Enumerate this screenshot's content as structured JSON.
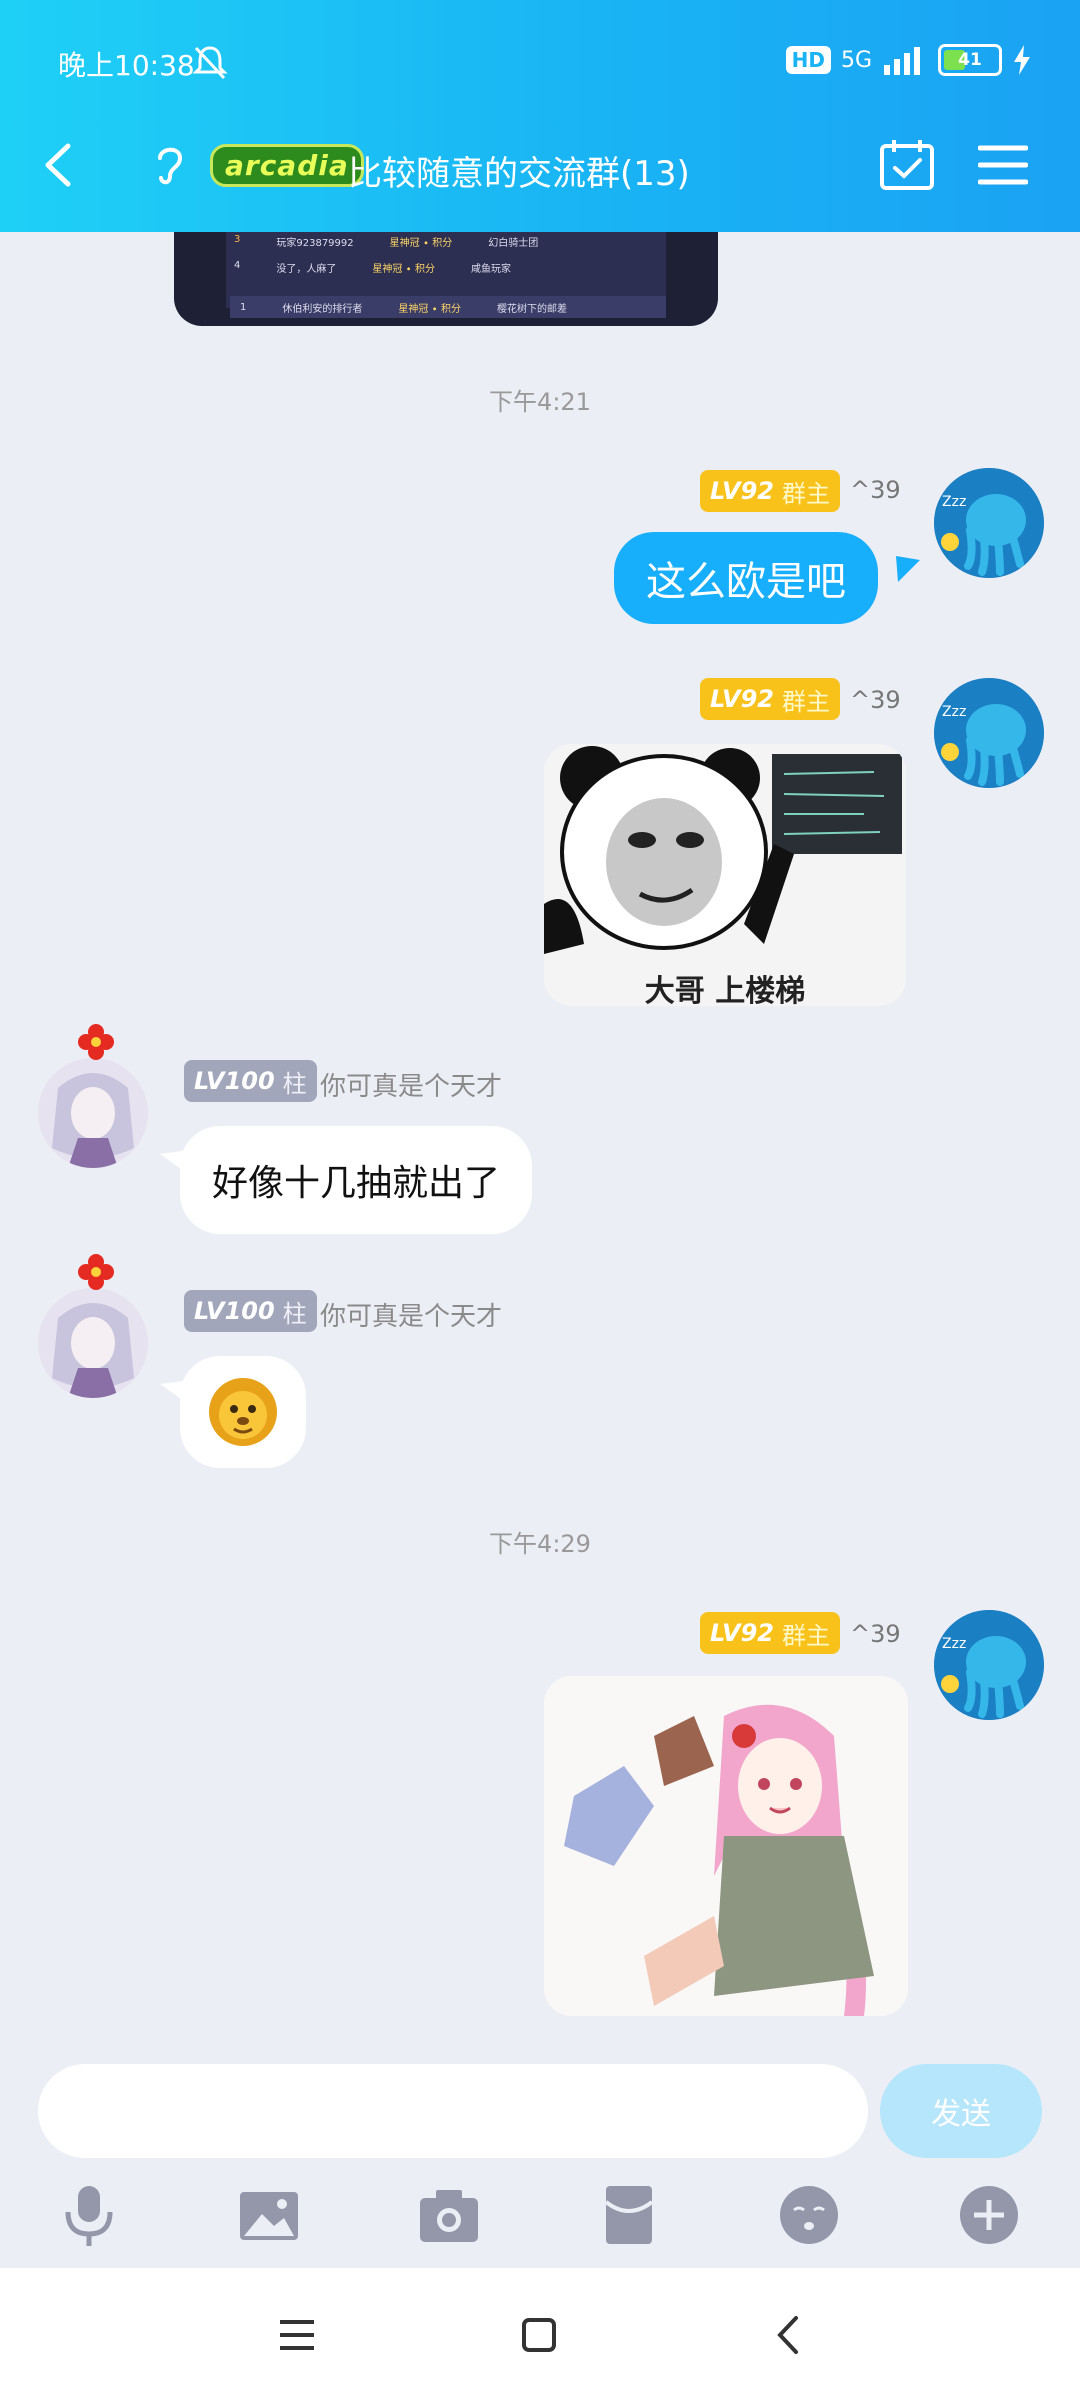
{
  "status_bar": {
    "time": "晚上10:38",
    "hd": "HD",
    "network": "5G",
    "battery": "41",
    "battery_level": 0.41
  },
  "header": {
    "group_tag": "arcadia",
    "title": "比较随意的交流群(13)"
  },
  "shared_image_top": {
    "rows": [
      {
        "rank": "3",
        "name": "玩家923879992",
        "score": "星神冠 ∙ 积分",
        "title": "幻白骑士团"
      },
      {
        "rank": "4",
        "name": "没了，人麻了",
        "score": "星神冠 ∙ 积分",
        "title": "咸鱼玩家"
      },
      {
        "rank": "1",
        "name": "休伯利安的排行者",
        "score": "星神冠 ∙ 积分",
        "title": "樱花树下的邮差"
      }
    ]
  },
  "messages": [
    {
      "type": "timestamp",
      "text": "下午4:21"
    },
    {
      "type": "outgoing",
      "level": "LV92",
      "role": "群主",
      "extra": "^39",
      "text": "这么欧是吧"
    },
    {
      "type": "outgoing",
      "level": "LV92",
      "role": "群主",
      "extra": "^39",
      "sticker_caption": "大哥 上楼梯"
    },
    {
      "type": "incoming",
      "level": "LV100",
      "role": "柱",
      "nickname": "你可真是个天才",
      "text": "好像十几抽就出了"
    },
    {
      "type": "incoming",
      "level": "LV100",
      "role": "柱",
      "nickname": "你可真是个天才",
      "emoji": "lion-face-emoji"
    },
    {
      "type": "timestamp",
      "text": "下午4:29"
    },
    {
      "type": "outgoing",
      "level": "LV92",
      "role": "群主",
      "extra": "^39",
      "image": "anime-girl-sticker"
    }
  ],
  "input": {
    "placeholder": "",
    "send_label": "发送"
  },
  "toolbar": {
    "icons": [
      "microphone-icon",
      "image-icon",
      "camera-icon",
      "red-packet-icon",
      "emoji-icon",
      "plus-icon"
    ]
  },
  "nav": {
    "icons": [
      "menu-icon",
      "home-icon",
      "back-icon"
    ]
  },
  "colors": {
    "header_start": "#1fd0f6",
    "header_end": "#1aa2f3",
    "outgoing_bubble": "#17aefb",
    "badge_gold": "#f9c21a",
    "badge_gray": "#a2a6bb",
    "background": "#eceef5"
  }
}
